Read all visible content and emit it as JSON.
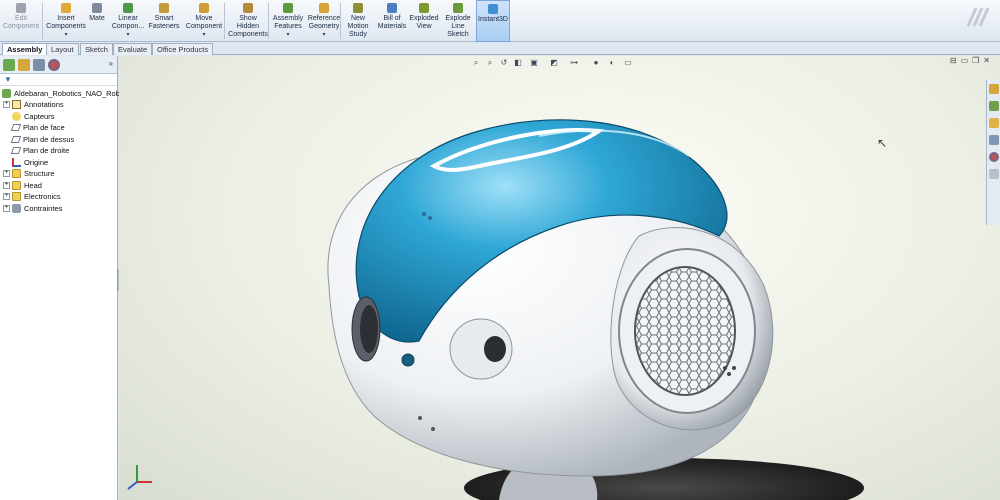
{
  "ribbon": {
    "buttons": [
      {
        "id": "edit-component",
        "label": "Edit\nComponent",
        "icon": "edit-component-icon",
        "enabled": false,
        "has_dropdown": false
      },
      {
        "id": "insert-components",
        "label": "Insert\nComponents",
        "icon": "insert-components-icon",
        "enabled": true,
        "has_dropdown": true
      },
      {
        "id": "mate",
        "label": "Mate",
        "icon": "mate-icon",
        "enabled": true,
        "has_dropdown": false
      },
      {
        "id": "linear-component",
        "label": "Linear\nCompon...",
        "icon": "linear-pattern-icon",
        "enabled": true,
        "has_dropdown": true
      },
      {
        "id": "smart-fasteners",
        "label": "Smart\nFasteners",
        "icon": "smart-fasteners-icon",
        "enabled": true,
        "has_dropdown": false
      },
      {
        "id": "move-component",
        "label": "Move\nComponent",
        "icon": "move-component-icon",
        "enabled": true,
        "has_dropdown": true
      },
      {
        "id": "show-hidden",
        "label": "Show\nHidden\nComponents",
        "icon": "show-hidden-icon",
        "enabled": true,
        "has_dropdown": false
      },
      {
        "id": "assembly-features",
        "label": "Assembly\nFeatures",
        "icon": "assembly-features-icon",
        "enabled": true,
        "has_dropdown": true
      },
      {
        "id": "reference-geometry",
        "label": "Reference\nGeometry",
        "icon": "reference-geometry-icon",
        "enabled": true,
        "has_dropdown": true
      },
      {
        "id": "new-motion-study",
        "label": "New\nMotion\nStudy",
        "icon": "motion-study-icon",
        "enabled": true,
        "has_dropdown": false
      },
      {
        "id": "bill-of-materials",
        "label": "Bill of\nMaterials",
        "icon": "bom-icon",
        "enabled": true,
        "has_dropdown": false
      },
      {
        "id": "exploded-view",
        "label": "Exploded\nView",
        "icon": "exploded-view-icon",
        "enabled": true,
        "has_dropdown": false
      },
      {
        "id": "explode-line-sketch",
        "label": "Explode\nLine\nSketch",
        "icon": "explode-line-icon",
        "enabled": true,
        "has_dropdown": false
      },
      {
        "id": "instant3d",
        "label": "Instant3D",
        "icon": "instant3d-icon",
        "enabled": true,
        "has_dropdown": false,
        "active": true
      }
    ]
  },
  "tabs": [
    "Assembly",
    "Layout",
    "Sketch",
    "Evaluate",
    "Office Products"
  ],
  "active_tab": "Assembly",
  "feature_tree": {
    "root": "Aldebaran_Robotics_NAO_Rob",
    "items": [
      {
        "label": "Annotations",
        "icon": "annotations-icon",
        "expandable": true
      },
      {
        "label": "Capteurs",
        "icon": "sensors-icon",
        "expandable": false
      },
      {
        "label": "Plan de face",
        "icon": "plane-icon",
        "expandable": false
      },
      {
        "label": "Plan de dessus",
        "icon": "plane-icon",
        "expandable": false
      },
      {
        "label": "Plan de droite",
        "icon": "plane-icon",
        "expandable": false
      },
      {
        "label": "Origine",
        "icon": "origin-icon",
        "expandable": false
      },
      {
        "label": "Structure",
        "icon": "folder-icon",
        "expandable": true
      },
      {
        "label": "Head",
        "icon": "folder-icon",
        "expandable": true
      },
      {
        "label": "Electronics",
        "icon": "folder-icon",
        "expandable": true
      },
      {
        "label": "Contraintes",
        "icon": "mates-icon",
        "expandable": true
      }
    ]
  },
  "colors": {
    "head_blue": "#1e8fc0",
    "head_white": "#f4f6f8",
    "grille": "#777e86",
    "ribbon_active": "#a9cdf4"
  },
  "viewport": {
    "model": "NAO robot head",
    "triad_labels": [
      "X",
      "Y",
      "Z"
    ]
  }
}
